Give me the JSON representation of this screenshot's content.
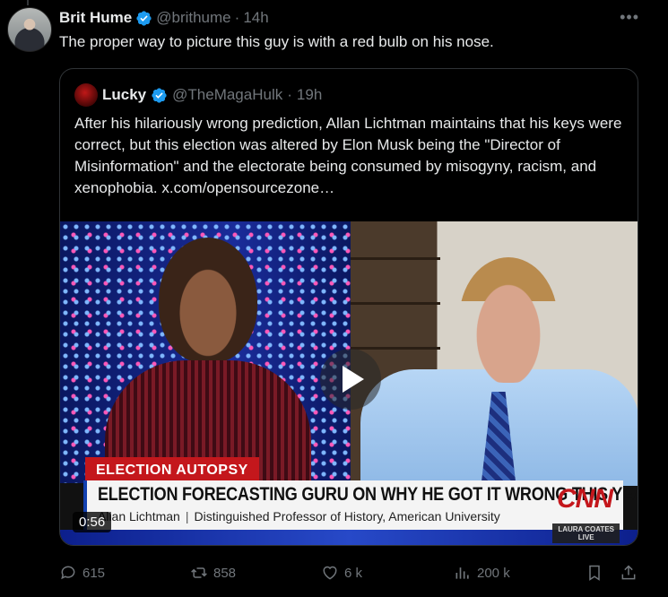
{
  "tweet": {
    "author_name": "Brit Hume",
    "author_handle": "@brithume",
    "separator": "·",
    "time": "14h",
    "text": "The proper way to picture this guy is with a red bulb on his nose.",
    "more_icon": "more-horizontal-icon",
    "verified_icon": "verified-badge-icon",
    "verified_color": "#1d9bf0"
  },
  "quote": {
    "author_name": "Lucky",
    "author_handle": "@TheMagaHulk",
    "separator": "·",
    "time": "19h",
    "text": "After his hilariously wrong prediction, Allan Lichtman maintains that his keys were correct, but this election was altered by Elon Musk being the \"Director of Misinformation\" and the electorate being consumed by misogyny, racism, and xenophobia.  x.com/opensourcezone…",
    "video": {
      "play_icon": "play-icon",
      "duration": "0:56",
      "chyron_tag": "ELECTION AUTOPSY",
      "chyron_headline": "ELECTION FORECASTING GURU ON WHY HE GOT IT WRONG THIS YEAR",
      "chyron_name": "Allan Lichtman",
      "chyron_separator": "|",
      "chyron_title": "Distinguished Professor of History, American University",
      "network_logo": "CNN",
      "live_tag_line1": "LAURA COATES",
      "live_tag_line2": "LIVE"
    }
  },
  "actions": {
    "replies": "615",
    "reposts": "858",
    "likes": "6 k",
    "views": "200 k",
    "icons": [
      "reply-icon",
      "repost-icon",
      "like-icon",
      "views-icon",
      "bookmark-icon",
      "share-icon"
    ]
  },
  "colors": {
    "background": "#000000",
    "text_primary": "#e7e9ea",
    "text_secondary": "#71767b",
    "border": "#2f3336",
    "cnn_red": "#c4171c"
  }
}
